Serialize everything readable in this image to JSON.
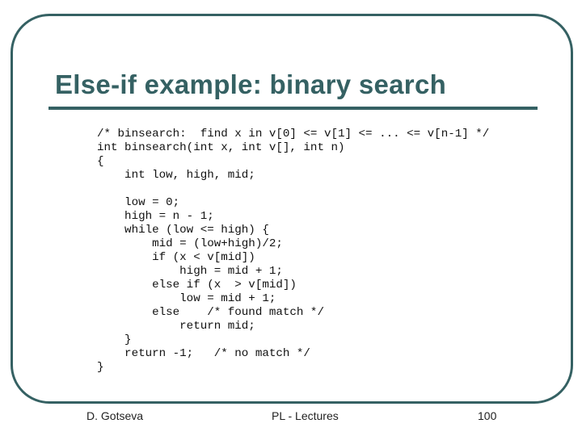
{
  "slide": {
    "title": "Else-if example: binary search",
    "accent_color": "#356163",
    "code_lines": [
      "/* binsearch:  find x in v[0] <= v[1] <= ... <= v[n-1] */",
      "int binsearch(int x, int v[], int n)",
      "{",
      "    int low, high, mid;",
      "",
      "    low = 0;",
      "    high = n - 1;",
      "    while (low <= high) {",
      "        mid = (low+high)/2;",
      "        if (x < v[mid])",
      "            high = mid + 1;",
      "        else if (x  > v[mid])",
      "            low = mid + 1;",
      "        else    /* found match */",
      "            return mid;",
      "    }",
      "    return -1;   /* no match */",
      "}"
    ]
  },
  "footer": {
    "author": "D. Gotseva",
    "course": "PL - Lectures",
    "page_number": "100"
  }
}
